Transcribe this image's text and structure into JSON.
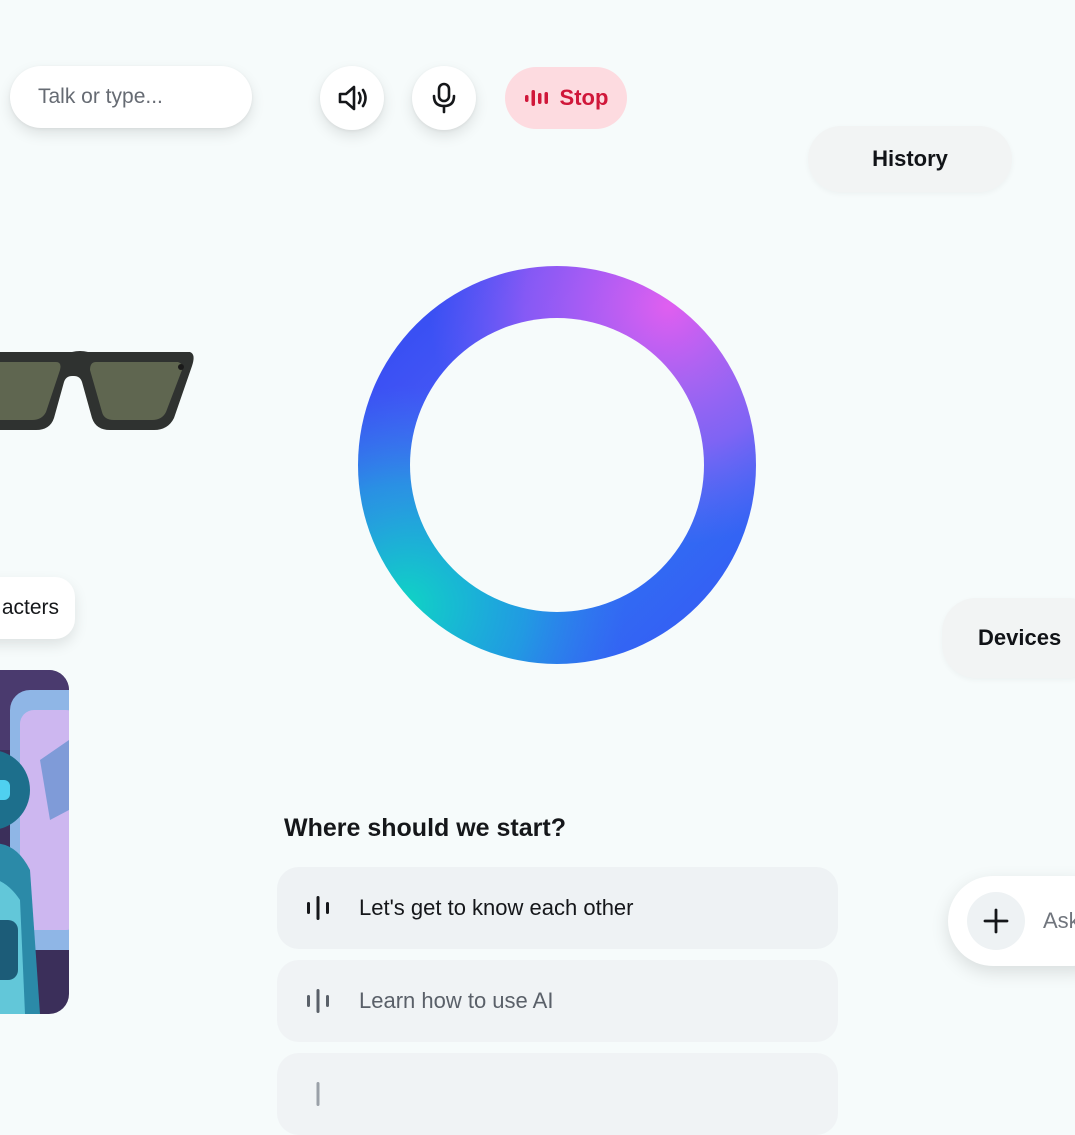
{
  "top_bar": {
    "input_placeholder": "Talk or type...",
    "speaker_icon": "speaker-volume-icon",
    "mic_icon": "microphone-icon",
    "stop_label": "Stop",
    "stop_icon": "voice-bars-icon"
  },
  "nav": {
    "history_label": "History",
    "devices_label": "Devices",
    "characters_label": "acters"
  },
  "ring": {
    "colors": [
      "#2f55f5",
      "#c85cf0",
      "#1fc7c9",
      "#3a5ef7"
    ]
  },
  "prompts": {
    "heading": "Where should we start?",
    "items": [
      {
        "label": "Let's get to know each other",
        "icon": "voice-bars-icon"
      },
      {
        "label": "Learn how to use AI",
        "icon": "voice-bars-icon"
      },
      {
        "label": "",
        "icon": "voice-bars-icon"
      }
    ]
  },
  "ask": {
    "label": "Ask",
    "icon": "plus-icon"
  },
  "colors": {
    "background": "#f6fbfb",
    "stop_bg": "#fddbe0",
    "stop_text": "#d0173a",
    "pill_grey": "#f2f4f4"
  }
}
